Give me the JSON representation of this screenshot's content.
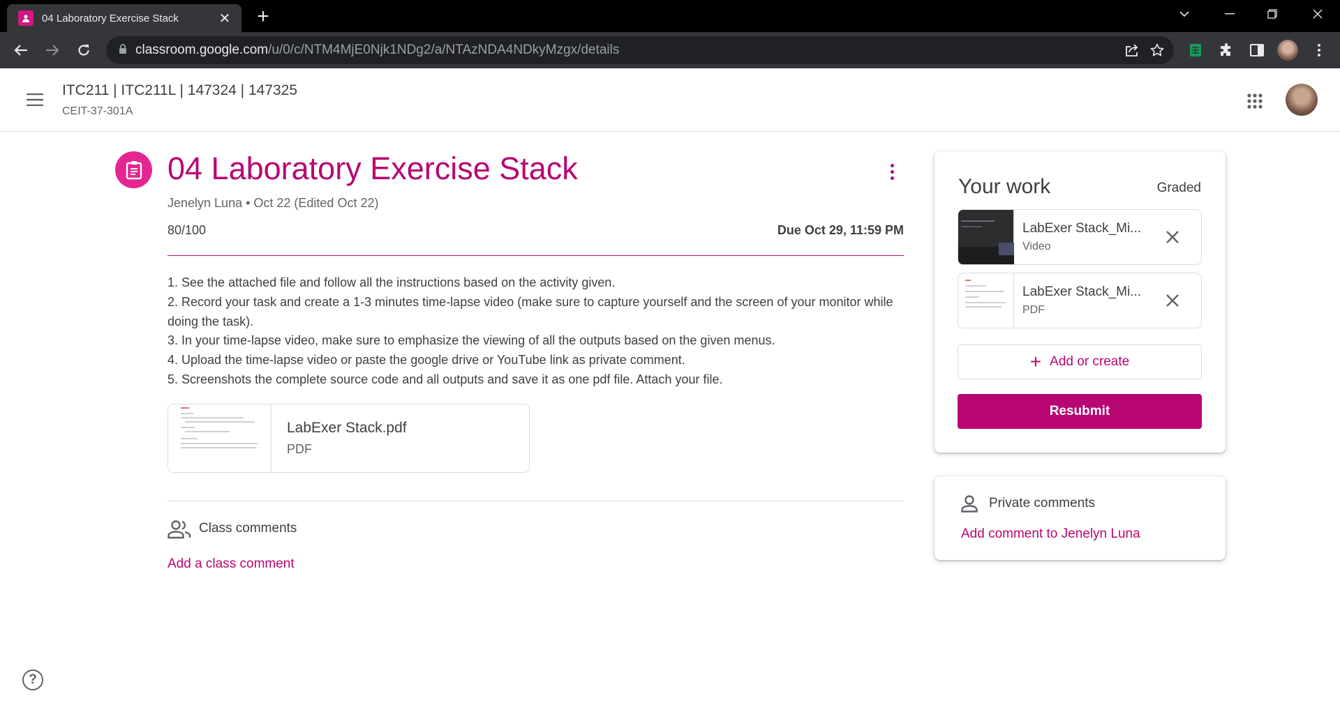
{
  "browser": {
    "tab_title": "04 Laboratory Exercise Stack",
    "url_host": "classroom.google.com",
    "url_path": "/u/0/c/NTM4MjE0Njk1NDg2/a/NTAzNDA4NDkyMzgx/details"
  },
  "header": {
    "class_name": "ITC211 | ITC211L | 147324 | 147325",
    "section": "CEIT-37-301A"
  },
  "assignment": {
    "title": "04 Laboratory Exercise Stack",
    "meta": "Jenelyn Luna • Oct 22 (Edited Oct 22)",
    "points": "80/100",
    "due": "Due Oct 29, 11:59 PM",
    "instructions": [
      "1. See the attached file and follow all the instructions based on the activity given.",
      "2. Record your task and create a 1-3 minutes time-lapse video (make sure to capture yourself and the screen of your monitor while doing the task).",
      "3. In your time-lapse video, make sure to emphasize the viewing of all the outputs based on the given menus.",
      "4. Upload the time-lapse video or paste the google drive or YouTube link as private comment.",
      "5. Screenshots the complete source code and all outputs and save it as one pdf file. Attach your file."
    ],
    "attachment": {
      "name": "LabExer Stack.pdf",
      "type": "PDF"
    }
  },
  "class_comments": {
    "label": "Class comments",
    "add_label": "Add a class comment"
  },
  "your_work": {
    "title": "Your work",
    "status": "Graded",
    "items": [
      {
        "name": "LabExer Stack_Mi...",
        "type": "Video"
      },
      {
        "name": "LabExer Stack_Mi...",
        "type": "PDF"
      }
    ],
    "add_label": "Add or create",
    "resubmit_label": "Resubmit"
  },
  "private_comments": {
    "label": "Private comments",
    "add_label": "Add comment to Jenelyn Luna"
  },
  "colors": {
    "accent": "#b80672",
    "accent_icon": "#e52592",
    "chrome_dark": "#35363a"
  },
  "icons": [
    "classroom-favicon",
    "close-icon",
    "plus-icon",
    "back-icon",
    "forward-icon",
    "reload-icon",
    "lock-icon",
    "share-icon",
    "star-icon",
    "extension-icon",
    "sidepanel-icon",
    "menu-icon",
    "apps-icon",
    "assignment-icon",
    "more-vert-icon",
    "people-icon",
    "person-icon",
    "help-icon"
  ]
}
